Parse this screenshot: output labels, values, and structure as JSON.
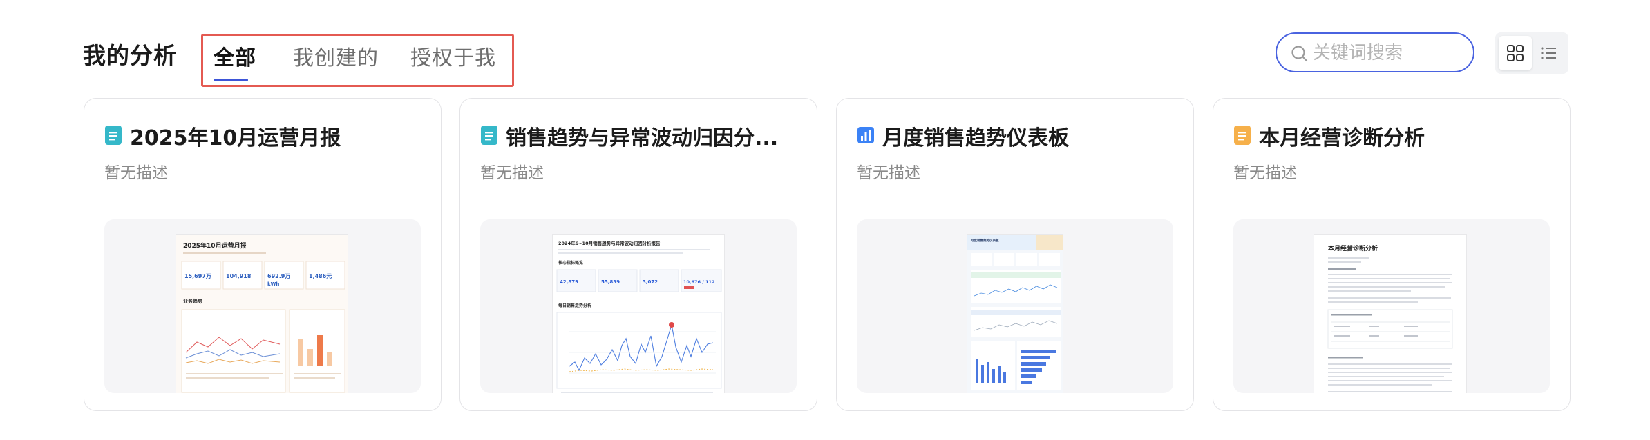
{
  "header": {
    "title": "我的分析",
    "tabs": [
      {
        "label": "全部",
        "active": true
      },
      {
        "label": "我创建的",
        "active": false
      },
      {
        "label": "授权于我",
        "active": false
      }
    ],
    "search_placeholder": "关键词搜索"
  },
  "view_toggle": {
    "selected": "grid"
  },
  "cards": [
    {
      "title": "2025年10月运营月报",
      "description": "暂无描述",
      "icon": "document-teal-icon",
      "thumb": {
        "heading": "2025年10月运营月报",
        "section": "业务趋势",
        "kpis": [
          "15,697万",
          "104,918",
          "692.9万",
          "1,486元"
        ],
        "kpi_sub": "kWh"
      }
    },
    {
      "title": "销售趋势与异常波动归因分...",
      "description": "暂无描述",
      "icon": "document-teal-icon",
      "thumb": {
        "heading": "2024年6~10月销售趋势与异常波动归因分析报告",
        "section1": "核心指标概览",
        "section2": "每日销售走势分析",
        "kpis": [
          "42,879",
          "55,839",
          "3,072",
          "10,676 / 112"
        ]
      }
    },
    {
      "title": "月度销售趋势仪表板",
      "description": "暂无描述",
      "icon": "bar-chart-blue-icon",
      "thumb": {
        "heading": "月度销售趋势仪表板"
      }
    },
    {
      "title": "本月经营诊断分析",
      "description": "暂无描述",
      "icon": "document-orange-icon",
      "thumb": {
        "heading": "本月经营诊断分析"
      }
    }
  ],
  "colors": {
    "accent": "#3d55d8",
    "highlight_box": "#e45a52",
    "teal_icon": "#35b8c9",
    "blue_icon": "#3b82f6",
    "orange_icon": "#f6b04a"
  }
}
